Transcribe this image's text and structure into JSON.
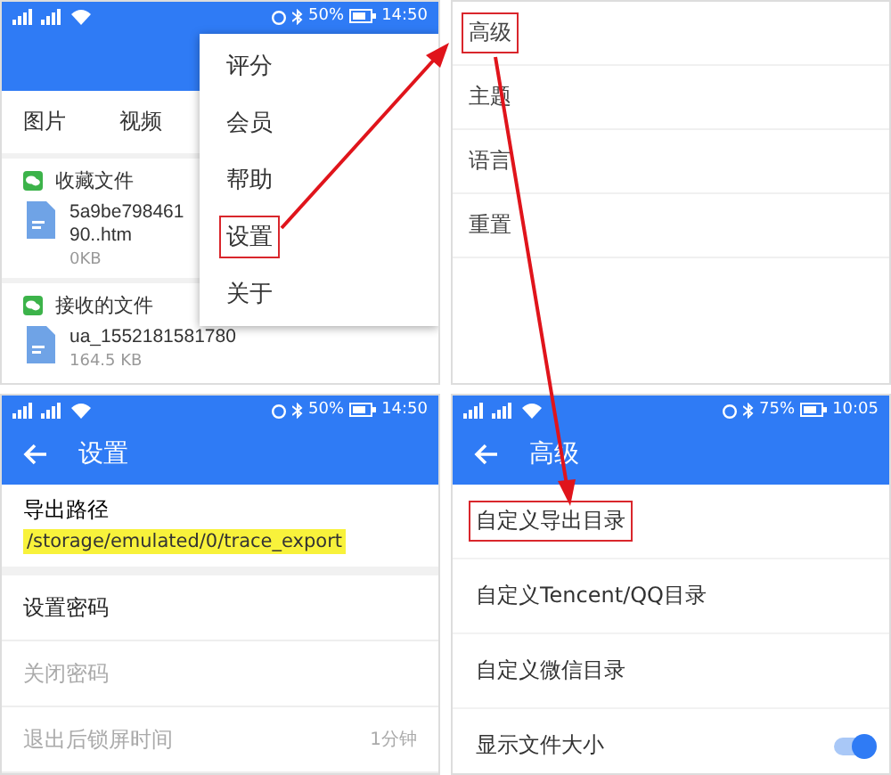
{
  "file_screen": {
    "status_bar": {
      "battery": "50%",
      "time": "14:50"
    },
    "tabs": [
      {
        "label": "图片"
      },
      {
        "label": "视频"
      }
    ],
    "groups": [
      {
        "title": "收藏文件",
        "files": [
          {
            "name_lines": [
              "5a9be798461",
              "90..htm"
            ],
            "size": "0KB"
          }
        ]
      },
      {
        "title": "接收的文件",
        "files": [
          {
            "name_lines": [
              "ua_1552181581780"
            ],
            "size": "164.5 KB"
          }
        ]
      }
    ],
    "menu": {
      "items": [
        {
          "label": "评分",
          "highlighted": false
        },
        {
          "label": "会员",
          "highlighted": false
        },
        {
          "label": "帮助",
          "highlighted": false
        },
        {
          "label": "设置",
          "highlighted": true
        },
        {
          "label": "关于",
          "highlighted": false
        }
      ]
    }
  },
  "settings_list": {
    "items": [
      {
        "label": "高级",
        "highlighted": true
      },
      {
        "label": "主题",
        "highlighted": false
      },
      {
        "label": "语言",
        "highlighted": false
      },
      {
        "label": "重置",
        "highlighted": false
      }
    ]
  },
  "settings_screen": {
    "status_bar": {
      "battery": "50%",
      "time": "14:50"
    },
    "title": "设置",
    "items": [
      {
        "kind": "path",
        "label": "导出路径",
        "value": "/storage/emulated/0/trace_export",
        "highlighted": true,
        "disabled": false
      },
      {
        "kind": "plain",
        "label": "设置密码",
        "disabled": false
      },
      {
        "kind": "plain",
        "label": "关闭密码",
        "disabled": true
      },
      {
        "kind": "value",
        "label": "退出后锁屏时间",
        "value": "1分钟",
        "disabled": true
      }
    ]
  },
  "advanced_screen": {
    "status_bar": {
      "battery": "75%",
      "time": "10:05"
    },
    "title": "高级",
    "items": [
      {
        "kind": "plain",
        "label": "自定义导出目录",
        "highlighted": true
      },
      {
        "kind": "plain",
        "label": "自定义Tencent/QQ目录",
        "highlighted": false
      },
      {
        "kind": "plain",
        "label": "自定义微信目录",
        "highlighted": false
      },
      {
        "kind": "toggle",
        "label": "显示文件大小",
        "highlighted": false,
        "on": true
      }
    ]
  }
}
